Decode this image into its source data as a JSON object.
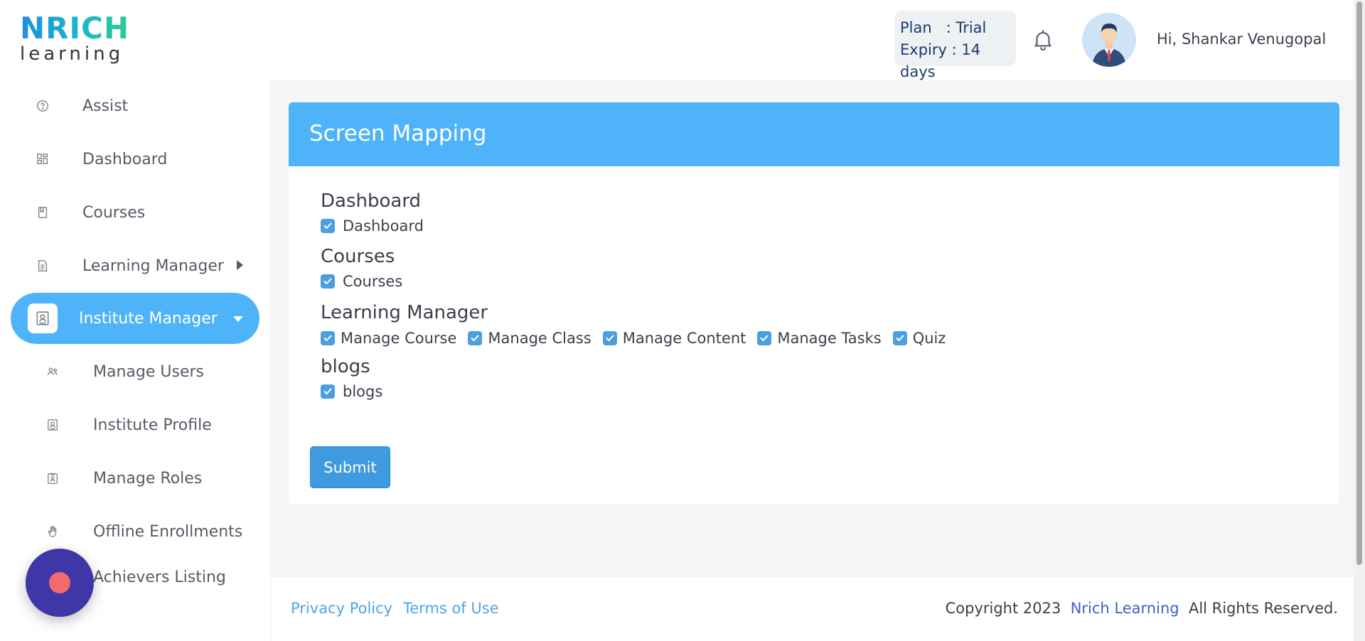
{
  "brand": {
    "logo_top": "NRICH",
    "logo_bottom": "learning"
  },
  "header": {
    "plan_line": "Plan   : Trial",
    "expiry_line": "Expiry : 14 days",
    "greeting": "Hi, Shankar Venugopal"
  },
  "sidebar": {
    "items": [
      {
        "label": "Assist",
        "icon": "help-circle-icon"
      },
      {
        "label": "Dashboard",
        "icon": "dashboard-grid-icon"
      },
      {
        "label": "Courses",
        "icon": "book-icon"
      },
      {
        "label": "Learning Manager",
        "icon": "document-icon"
      },
      {
        "label": "Institute Manager",
        "icon": "id-card-icon"
      }
    ],
    "sub_items": [
      {
        "label": "Manage Users",
        "icon": "users-icon"
      },
      {
        "label": "Institute Profile",
        "icon": "profile-card-icon"
      },
      {
        "label": "Manage Roles",
        "icon": "badge-icon"
      },
      {
        "label": "Offline Enrollments",
        "icon": "hand-icon"
      },
      {
        "label": "Achievers Listing",
        "icon": "trophy-icon"
      }
    ]
  },
  "card": {
    "title": "Screen Mapping",
    "sections": [
      {
        "title": "Dashboard",
        "checkboxes": [
          {
            "label": "Dashboard",
            "checked": true
          }
        ]
      },
      {
        "title": "Courses",
        "checkboxes": [
          {
            "label": "Courses",
            "checked": true
          }
        ]
      },
      {
        "title": "Learning Manager",
        "checkboxes": [
          {
            "label": "Manage Course",
            "checked": true
          },
          {
            "label": "Manage Class",
            "checked": true
          },
          {
            "label": "Manage Content",
            "checked": true
          },
          {
            "label": "Manage Tasks",
            "checked": true
          },
          {
            "label": "Quiz",
            "checked": true
          }
        ]
      },
      {
        "title": "blogs",
        "checkboxes": [
          {
            "label": "blogs",
            "checked": true
          }
        ]
      }
    ],
    "submit_label": "Submit"
  },
  "footer": {
    "privacy": "Privacy Policy",
    "terms": "Terms of Use",
    "copyright_prefix": "Copyright 2023",
    "copyright_brand": "Nrich Learning",
    "copyright_suffix": "All Rights Reserved."
  },
  "colors": {
    "accent": "#4fb3fa",
    "checkbox": "#4a9fe0",
    "fab": "#3f37a8",
    "fab_dot": "#f26b6b",
    "link": "#4fa6e6"
  }
}
